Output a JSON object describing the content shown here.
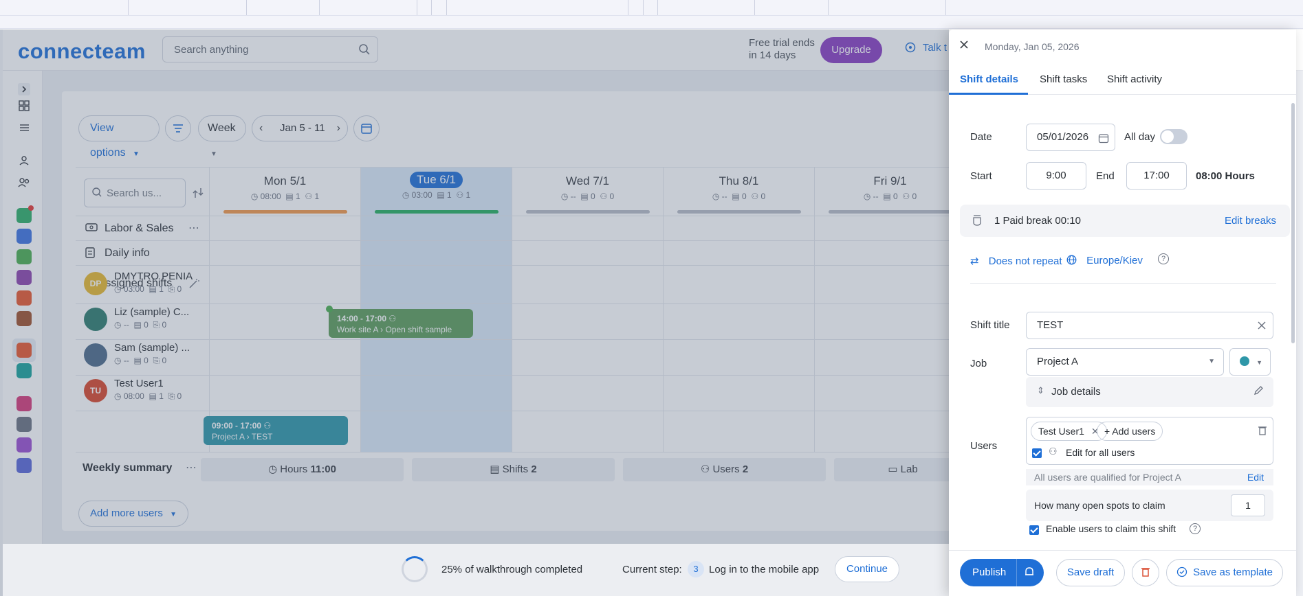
{
  "header": {
    "logo": "connecteam",
    "search_placeholder": "Search anything",
    "trial_text": "Free trial ends in 14 days",
    "upgrade_label": "Upgrade",
    "talk_label": "Talk t"
  },
  "scheduler": {
    "view_options_label": "View options",
    "week_label": "Week",
    "date_range": "Jan 5 - 11",
    "search_users_placeholder": "Search us...",
    "days": [
      {
        "name": "Mon 5/1",
        "hours": "08:00",
        "shifts": "1",
        "users": "1",
        "bar_color": "#f2994a",
        "today": false
      },
      {
        "name": "Tue 6/1",
        "hours": "03:00",
        "shifts": "1",
        "users": "1",
        "bar_color": "#27ae60",
        "today": true
      },
      {
        "name": "Wed 7/1",
        "hours": "--",
        "shifts": "0",
        "users": "0",
        "bar_color": "#b7bcc6",
        "today": false
      },
      {
        "name": "Thu 8/1",
        "hours": "--",
        "shifts": "0",
        "users": "0",
        "bar_color": "#b7bcc6",
        "today": false
      },
      {
        "name": "Fri 9/1",
        "hours": "--",
        "shifts": "0",
        "users": "0",
        "bar_color": "#b7bcc6",
        "today": false
      }
    ],
    "rows": {
      "labor_sales": "Labor & Sales",
      "daily_info": "Daily info",
      "unassigned_shifts": "Unassigned shifts"
    },
    "users": [
      {
        "initials": "DP",
        "name": "DMYTRO PENIA",
        "hours": "03:00",
        "shifts": "1",
        "tasks": "0",
        "color": "#e8b82e"
      },
      {
        "initials": "",
        "name": "Liz (sample) C...",
        "hours": "--",
        "shifts": "0",
        "tasks": "0",
        "color": "#2f7d6d"
      },
      {
        "initials": "",
        "name": "Sam (sample) ...",
        "hours": "--",
        "shifts": "0",
        "tasks": "0",
        "color": "#4d6b8a"
      },
      {
        "initials": "TU",
        "name": "Test User1",
        "hours": "08:00",
        "shifts": "1",
        "tasks": "0",
        "color": "#d9472b"
      }
    ],
    "shift_open": {
      "time": "14:00 - 17:00",
      "detail": "Work site A › Open shift sample",
      "color": "#5e9d5a"
    },
    "shift_user": {
      "time": "09:00 - 17:00",
      "detail": "Project A › TEST",
      "color": "#2e97a8"
    },
    "weekly_summary": {
      "label": "Weekly summary",
      "hours_label": "Hours",
      "hours_value": "11:00",
      "shifts_label": "Shifts",
      "shifts_value": "2",
      "users_label": "Users",
      "users_value": "2",
      "labor_label": "Lab"
    },
    "add_more_users": "Add more users"
  },
  "walkthrough": {
    "progress_text": "25% of walkthrough completed",
    "progress_percent": 25,
    "current_step_label": "Current step:",
    "step_number": "3",
    "step_text": "Log in to the mobile app",
    "continue_label": "Continue"
  },
  "panel": {
    "date_title": "Monday, Jan 05, 2026",
    "tabs": [
      "Shift details",
      "Shift tasks",
      "Shift activity"
    ],
    "date_label": "Date",
    "date_value": "05/01/2026",
    "all_day_label": "All day",
    "start_label": "Start",
    "start_value": "9:00",
    "end_label": "End",
    "end_value": "17:00",
    "duration": "08:00 Hours",
    "break_text": "1 Paid break 00:10",
    "edit_breaks": "Edit breaks",
    "repeat": "Does not repeat",
    "timezone": "Europe/Kiev",
    "shift_title_label": "Shift title",
    "shift_title_value": "TEST",
    "job_label": "Job",
    "job_value": "Project A",
    "job_color": "#2e97a8",
    "job_details": "Job details",
    "users_label": "Users",
    "user_chip": "Test User1",
    "add_users": "+ Add users",
    "edit_for_all": "Edit for all users",
    "qualified_text": "All users are qualified for Project A",
    "qualified_edit": "Edit",
    "open_spots_label": "How many open spots to claim",
    "open_spots_value": "1",
    "enable_claim": "Enable users to claim this shift",
    "publish": "Publish",
    "save_draft": "Save draft",
    "save_template": "Save as template"
  }
}
